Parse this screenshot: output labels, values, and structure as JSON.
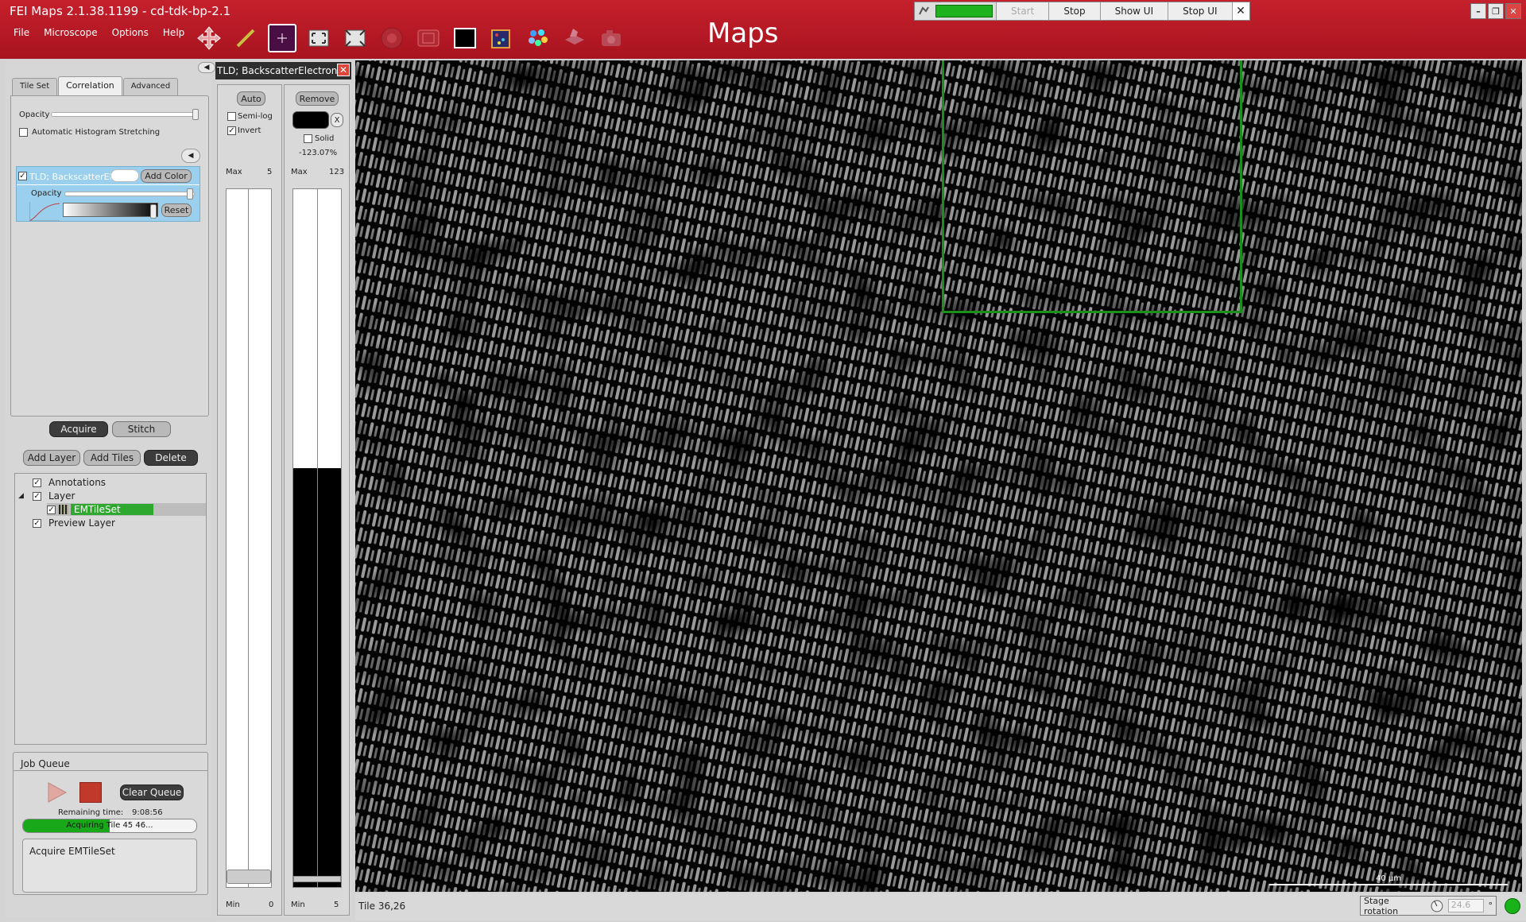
{
  "window": {
    "title": "FEI Maps 2.1.38.1199 - cd-tdk-bp-2.1",
    "brand": "Maps"
  },
  "menu": [
    "File",
    "Microscope",
    "Options",
    "Help"
  ],
  "toolbar_icons": [
    "pan-icon",
    "measure-icon",
    "crosshair-icon",
    "fit-icon",
    "full-extent-icon",
    "record-icon",
    "snapshot-icon",
    "black-screen-icon",
    "color-map-icon",
    "palette-icon",
    "stage-icon",
    "camera-icon"
  ],
  "job_controls": {
    "start": "Start",
    "stop": "Stop",
    "show_ui": "Show UI",
    "stop_ui": "Stop UI",
    "close": "✕"
  },
  "left_panel": {
    "tabs": [
      "Tile Set",
      "Correlation",
      "Advanced"
    ],
    "active_tab": "Correlation",
    "opacity_label": "Opacity",
    "auto_histogram_label": "Automatic Histogram Stretching",
    "auto_histogram_checked": false,
    "layer_name": "TLD; BackscatterEle",
    "add_color": "Add Color",
    "layer_opacity_label": "Opacity",
    "reset": "Reset",
    "acquire": "Acquire",
    "stitch": "Stitch",
    "add_layer": "Add Layer",
    "add_tiles": "Add Tiles",
    "delete": "Delete"
  },
  "tree": [
    {
      "label": "Annotations",
      "checked": true,
      "indent": 0
    },
    {
      "label": "Layer",
      "checked": true,
      "indent": 0,
      "expanded": true
    },
    {
      "label": "EMTileSet",
      "checked": true,
      "indent": 1,
      "selected": true
    },
    {
      "label": "Preview Layer",
      "checked": true,
      "indent": 0
    }
  ],
  "job_queue": {
    "title": "Job Queue",
    "clear": "Clear Queue",
    "remaining_label": "Remaining time:",
    "remaining_value": "9:08:56",
    "progress_text": "Acquiring Tile 45 46...",
    "progress": 0.5,
    "current_job": "Acquire EMTileSet"
  },
  "histogram": {
    "header": "TLD; BackscatterElectrons",
    "auto": "Auto",
    "semi_log": "Semi-log",
    "semi_log_checked": false,
    "invert": "Invert",
    "invert_checked": true,
    "remove": "Remove",
    "x_btn": "X",
    "solid": "Solid",
    "solid_checked": false,
    "percent": "-123.07%",
    "left_max_label": "Max",
    "left_max_value": "5",
    "left_min_label": "Min",
    "left_min_value": "0",
    "right_max_label": "Max",
    "right_max_value": "123",
    "right_min_label": "Min",
    "right_min_value": "5",
    "right_fill": 0.6
  },
  "view": {
    "scale_label": "40 µm"
  },
  "status": {
    "tile": "Tile 36,26",
    "stage_rotation_label": "Stage rotation",
    "stage_rotation_value": "24.6",
    "stage_rotation_unit": "°"
  },
  "colors": {
    "titlebar": "#b81a26",
    "roi": "#1b8e1b",
    "progress": "#1eb21e",
    "selected": "#2ea82e"
  }
}
